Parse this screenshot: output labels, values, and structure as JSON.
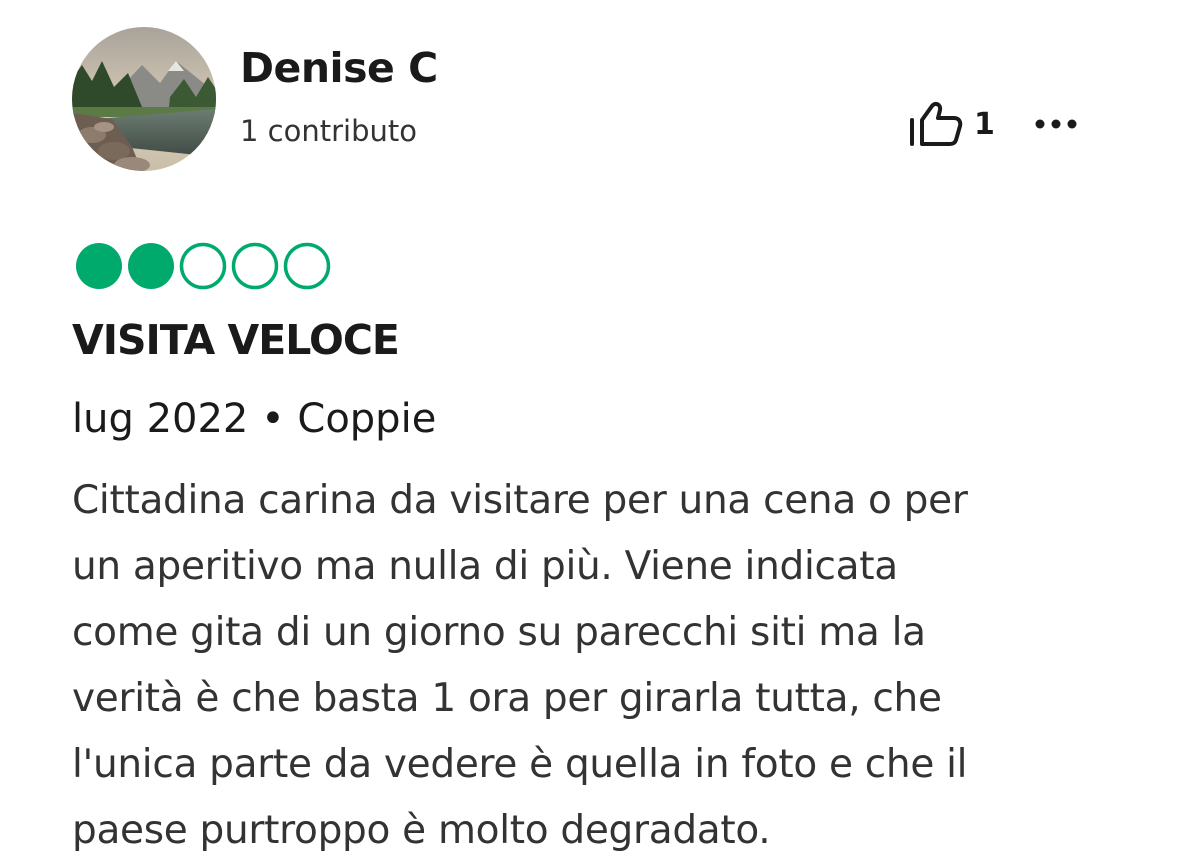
{
  "user": {
    "name": "Denise C",
    "contributions": "1 contributo",
    "avatar_icon": "landscape-photo-avatar"
  },
  "actions": {
    "helpful_icon": "thumbs-up-icon",
    "helpful_count": "1",
    "more_icon": "ellipsis-icon"
  },
  "rating": {
    "value": 2,
    "max": 5,
    "filled_color": "#00aa6c",
    "empty_color": "#00aa6c"
  },
  "review": {
    "title": "VISITA VELOCE",
    "meta": "lug 2022 • Coppie",
    "text_lines": [
      "Cittadina carina da visitare per una cena o per",
      "un aperitivo ma nulla di più. Viene indicata",
      "come gita di un giorno su parecchi siti ma la",
      "verità è che basta 1 ora per girarla tutta, che",
      "l'unica parte da vedere è quella in foto e che il",
      "paese purtroppo è molto degradato."
    ]
  }
}
